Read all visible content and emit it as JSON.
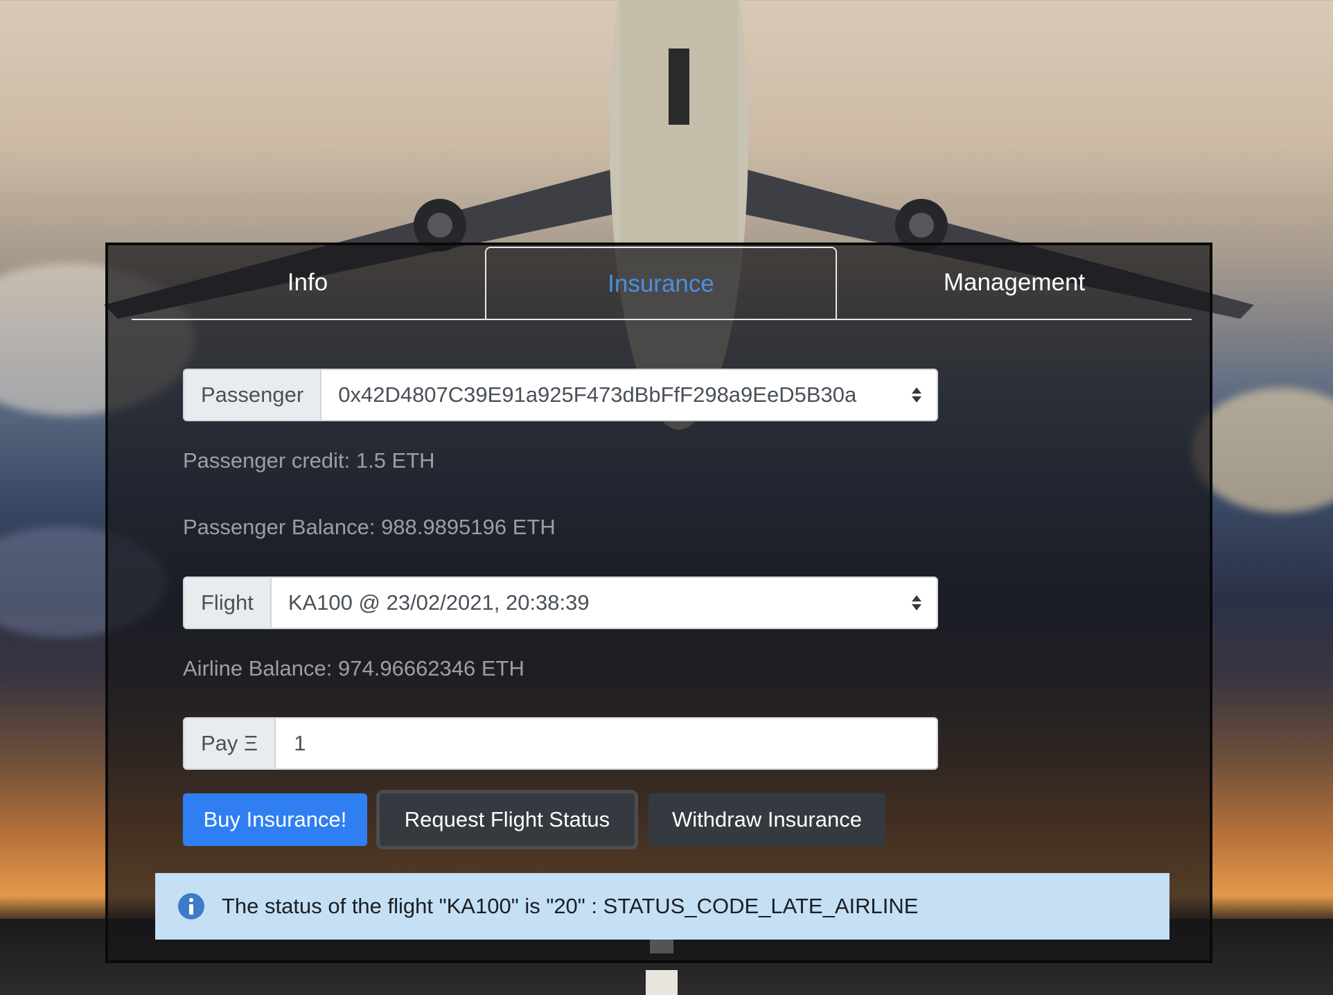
{
  "tabs": [
    {
      "label": "Info",
      "active": false
    },
    {
      "label": "Insurance",
      "active": true
    },
    {
      "label": "Management",
      "active": false
    }
  ],
  "passenger": {
    "addon_label": "Passenger",
    "selected_address": "0x42D4807C39E91a925F473dBbFfF298a9EeD5B30a",
    "credit_text": "Passenger credit: 1.5 ETH",
    "balance_text": "Passenger Balance: 988.9895196 ETH"
  },
  "flight": {
    "addon_label": "Flight",
    "selected": "KA100 @ 23/02/2021, 20:38:39"
  },
  "airline": {
    "balance_text": "Airline Balance: 974.96662346 ETH"
  },
  "pay": {
    "addon_label": "Pay Ξ",
    "value": "1"
  },
  "buttons": {
    "buy": "Buy Insurance!",
    "request_status": "Request Flight Status",
    "withdraw": "Withdraw Insurance"
  },
  "alert": {
    "message": "The status of the flight \"KA100\" is \"20\" : STATUS_CODE_LATE_AIRLINE",
    "icon": "info-circle-icon"
  },
  "colors": {
    "primary": "#2f7ff2",
    "dark_button": "#343a40",
    "active_tab": "#4a8fe0",
    "alert_bg": "#c5dff5"
  }
}
